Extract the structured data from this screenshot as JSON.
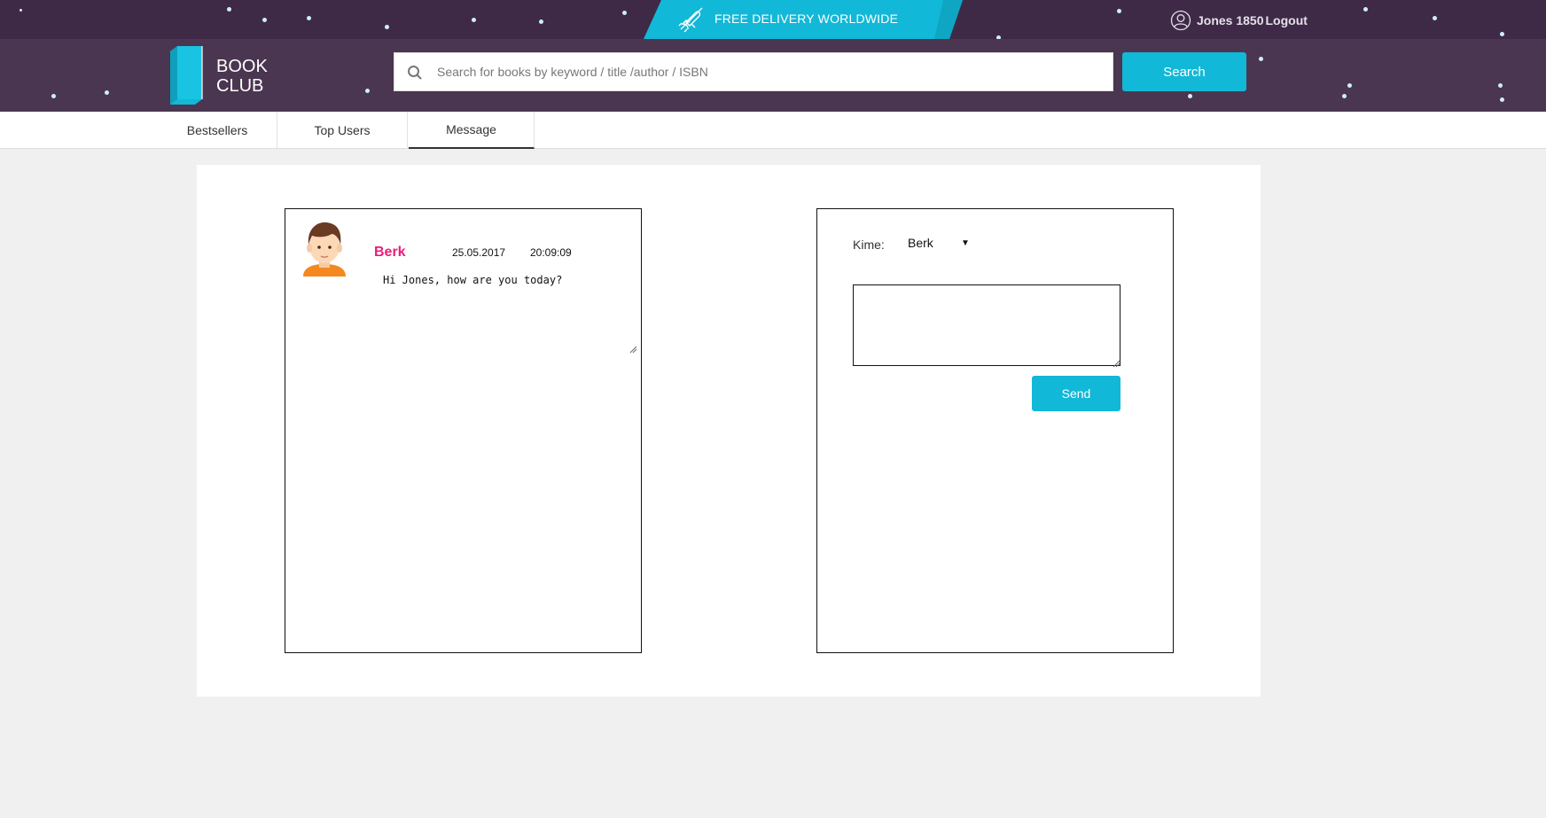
{
  "topbar": {
    "promo_text": "FREE DELIVERY WORLDWIDE",
    "promo_icon": "rocket-icon",
    "user_icon": "user-circle-icon",
    "username": "Jones 1850",
    "logout_label": "Logout"
  },
  "header": {
    "logo_line1": "BOOK",
    "logo_line2": "CLUB",
    "search_placeholder": "Search for books by keyword / title /author / ISBN",
    "search_button": "Search"
  },
  "nav": {
    "tabs": [
      {
        "label": "Bestsellers"
      },
      {
        "label": "Top Users"
      },
      {
        "label": "Message"
      }
    ],
    "active": "Message"
  },
  "inbox": {
    "messages": [
      {
        "sender": "Berk",
        "date": "25.05.2017",
        "time": "20:09:09",
        "text": "Hi Jones, how are you today?"
      }
    ]
  },
  "compose": {
    "to_label": "Kime:",
    "to_value": "Berk",
    "message_value": "",
    "send_label": "Send"
  },
  "colors": {
    "topbar": "#3e2a47",
    "header": "#4a3650",
    "accent": "#12b8d7",
    "sender_name": "#e91e7a"
  }
}
